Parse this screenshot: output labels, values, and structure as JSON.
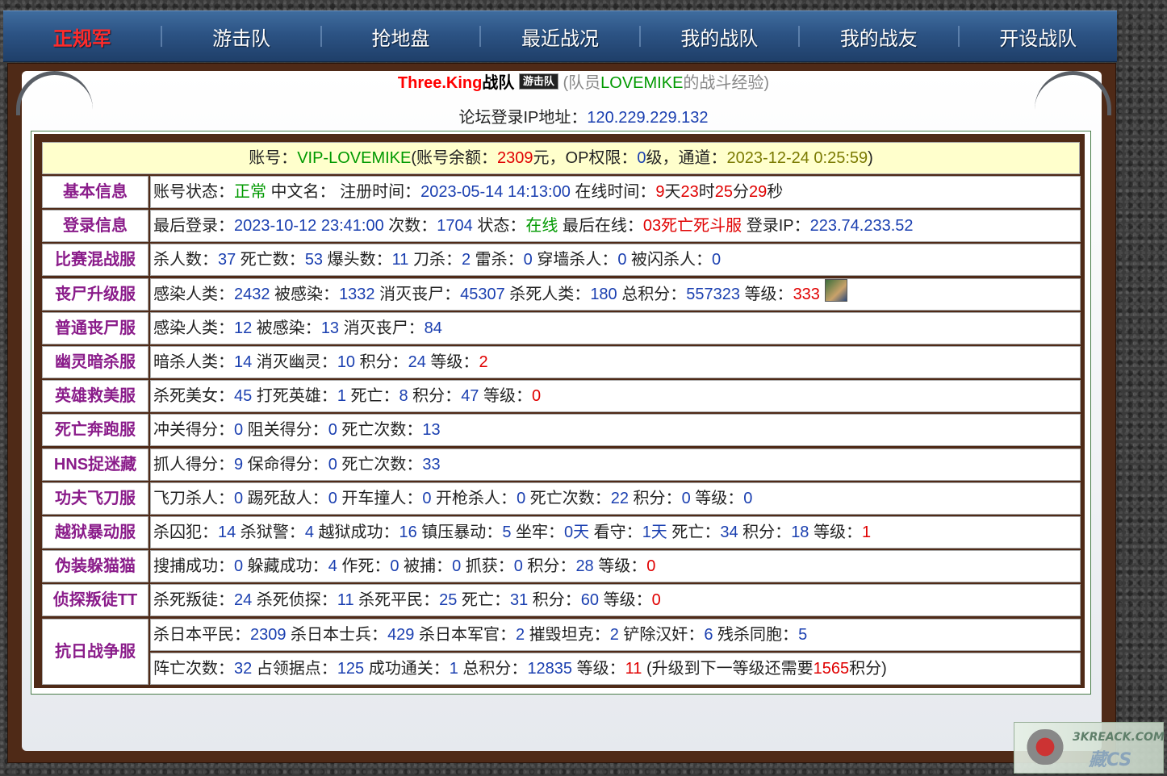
{
  "nav": [
    {
      "label": "正规军",
      "active": true
    },
    {
      "label": "游击队",
      "active": false
    },
    {
      "label": "抢地盘",
      "active": false
    },
    {
      "label": "最近战况",
      "active": false
    },
    {
      "label": "我的战队",
      "active": false
    },
    {
      "label": "我的战友",
      "active": false
    },
    {
      "label": "开设战队",
      "active": false
    }
  ],
  "header": {
    "team_name": "Three.King",
    "team_suffix": "战队",
    "badge": "游击队",
    "desc_prefix": "(队员",
    "member": "LOVEMIKE",
    "desc_suffix": "的战斗经验)"
  },
  "ip_line": {
    "label": "论坛登录IP地址：",
    "value": "120.229.229.132"
  },
  "account": {
    "label": "账号：",
    "account": "VIP-LOVEMIKE",
    "balance_label": "(账号余额：",
    "balance": "2309",
    "balance_unit": "元，",
    "op_label": "OP权限：",
    "op": "0",
    "op_unit": "级，",
    "channel_label": "通道：",
    "channel": "2023-12-24 0:25:59",
    "close": ")"
  },
  "rows": [
    {
      "label": "基本信息",
      "parts": [
        {
          "t": "账号状态："
        },
        {
          "t": "正常",
          "c": "green"
        },
        {
          "t": " 中文名：  注册时间："
        },
        {
          "t": "2023-05-14 14:13:00",
          "c": "blue"
        },
        {
          "t": " 在线时间："
        },
        {
          "t": "9",
          "c": "red"
        },
        {
          "t": "天"
        },
        {
          "t": "23",
          "c": "red"
        },
        {
          "t": "时"
        },
        {
          "t": "25",
          "c": "red"
        },
        {
          "t": "分"
        },
        {
          "t": "29",
          "c": "red"
        },
        {
          "t": "秒"
        }
      ]
    },
    {
      "label": "登录信息",
      "parts": [
        {
          "t": "最后登录："
        },
        {
          "t": "2023-10-12 23:41:00",
          "c": "blue"
        },
        {
          "t": " 次数："
        },
        {
          "t": "1704",
          "c": "blue"
        },
        {
          "t": " 状态："
        },
        {
          "t": "在线",
          "c": "green"
        },
        {
          "t": " 最后在线："
        },
        {
          "t": "03死亡死斗服",
          "c": "red"
        },
        {
          "t": " 登录IP："
        },
        {
          "t": "223.74.233.52",
          "c": "blue"
        }
      ]
    },
    {
      "label": "比赛混战服",
      "parts": [
        {
          "t": "杀人数："
        },
        {
          "t": "37",
          "c": "blue"
        },
        {
          "t": " 死亡数："
        },
        {
          "t": "53",
          "c": "blue"
        },
        {
          "t": " 爆头数："
        },
        {
          "t": "11",
          "c": "blue"
        },
        {
          "t": " 刀杀："
        },
        {
          "t": "2",
          "c": "blue"
        },
        {
          "t": " 雷杀："
        },
        {
          "t": "0",
          "c": "blue"
        },
        {
          "t": " 穿墙杀人："
        },
        {
          "t": "0",
          "c": "blue"
        },
        {
          "t": " 被闪杀人："
        },
        {
          "t": "0",
          "c": "blue"
        }
      ]
    },
    {
      "label": "丧尸升级服",
      "avatar": true,
      "parts": [
        {
          "t": "感染人类："
        },
        {
          "t": "2432",
          "c": "blue"
        },
        {
          "t": " 被感染："
        },
        {
          "t": "1332",
          "c": "blue"
        },
        {
          "t": " 消灭丧尸："
        },
        {
          "t": "45307",
          "c": "blue"
        },
        {
          "t": " 杀死人类："
        },
        {
          "t": "180",
          "c": "blue"
        },
        {
          "t": " 总积分："
        },
        {
          "t": "557323",
          "c": "blue"
        },
        {
          "t": " 等级："
        },
        {
          "t": "333",
          "c": "red"
        }
      ]
    },
    {
      "label": "普通丧尸服",
      "parts": [
        {
          "t": "感染人类："
        },
        {
          "t": "12",
          "c": "blue"
        },
        {
          "t": " 被感染："
        },
        {
          "t": "13",
          "c": "blue"
        },
        {
          "t": " 消灭丧尸："
        },
        {
          "t": "84",
          "c": "blue"
        }
      ]
    },
    {
      "label": "幽灵暗杀服",
      "parts": [
        {
          "t": "暗杀人类："
        },
        {
          "t": "14",
          "c": "blue"
        },
        {
          "t": " 消灭幽灵："
        },
        {
          "t": "10",
          "c": "blue"
        },
        {
          "t": " 积分："
        },
        {
          "t": "24",
          "c": "blue"
        },
        {
          "t": " 等级："
        },
        {
          "t": "2",
          "c": "red"
        }
      ]
    },
    {
      "label": "英雄救美服",
      "parts": [
        {
          "t": "杀死美女："
        },
        {
          "t": "45",
          "c": "blue"
        },
        {
          "t": " 打死英雄："
        },
        {
          "t": "1",
          "c": "blue"
        },
        {
          "t": " 死亡："
        },
        {
          "t": "8",
          "c": "blue"
        },
        {
          "t": " 积分："
        },
        {
          "t": "47",
          "c": "blue"
        },
        {
          "t": " 等级："
        },
        {
          "t": "0",
          "c": "red"
        }
      ]
    },
    {
      "label": "死亡奔跑服",
      "parts": [
        {
          "t": "冲关得分："
        },
        {
          "t": "0",
          "c": "blue"
        },
        {
          "t": " 阻关得分："
        },
        {
          "t": "0",
          "c": "blue"
        },
        {
          "t": " 死亡次数："
        },
        {
          "t": "13",
          "c": "blue"
        }
      ]
    },
    {
      "label": "HNS捉迷藏",
      "parts": [
        {
          "t": "抓人得分："
        },
        {
          "t": "9",
          "c": "blue"
        },
        {
          "t": " 保命得分："
        },
        {
          "t": "0",
          "c": "blue"
        },
        {
          "t": " 死亡次数："
        },
        {
          "t": "33",
          "c": "blue"
        }
      ]
    },
    {
      "label": "功夫飞刀服",
      "parts": [
        {
          "t": "飞刀杀人："
        },
        {
          "t": "0",
          "c": "blue"
        },
        {
          "t": " 踢死敌人："
        },
        {
          "t": "0",
          "c": "blue"
        },
        {
          "t": " 开车撞人："
        },
        {
          "t": "0",
          "c": "blue"
        },
        {
          "t": " 开枪杀人："
        },
        {
          "t": "0",
          "c": "blue"
        },
        {
          "t": " 死亡次数："
        },
        {
          "t": "22",
          "c": "blue"
        },
        {
          "t": " 积分："
        },
        {
          "t": "0",
          "c": "blue"
        },
        {
          "t": " 等级："
        },
        {
          "t": "0",
          "c": "blue"
        }
      ]
    },
    {
      "label": "越狱暴动服",
      "parts": [
        {
          "t": "杀囚犯："
        },
        {
          "t": "14",
          "c": "blue"
        },
        {
          "t": " 杀狱警："
        },
        {
          "t": "4",
          "c": "blue"
        },
        {
          "t": " 越狱成功："
        },
        {
          "t": "16",
          "c": "blue"
        },
        {
          "t": " 镇压暴动："
        },
        {
          "t": "5",
          "c": "blue"
        },
        {
          "t": " 坐牢："
        },
        {
          "t": "0天",
          "c": "blue"
        },
        {
          "t": " 看守："
        },
        {
          "t": "1天",
          "c": "blue"
        },
        {
          "t": " 死亡："
        },
        {
          "t": "34",
          "c": "blue"
        },
        {
          "t": " 积分："
        },
        {
          "t": "18",
          "c": "blue"
        },
        {
          "t": " 等级："
        },
        {
          "t": "1",
          "c": "red"
        }
      ]
    },
    {
      "label": "伪装躲猫猫",
      "parts": [
        {
          "t": "搜捕成功："
        },
        {
          "t": "0",
          "c": "blue"
        },
        {
          "t": " 躲藏成功："
        },
        {
          "t": "4",
          "c": "blue"
        },
        {
          "t": " 作死："
        },
        {
          "t": "0",
          "c": "blue"
        },
        {
          "t": " 被捕："
        },
        {
          "t": "0",
          "c": "blue"
        },
        {
          "t": " 抓获："
        },
        {
          "t": "0",
          "c": "blue"
        },
        {
          "t": " 积分："
        },
        {
          "t": "28",
          "c": "blue"
        },
        {
          "t": " 等级："
        },
        {
          "t": "0",
          "c": "red"
        }
      ]
    },
    {
      "label": "侦探叛徒TT",
      "parts": [
        {
          "t": "杀死叛徒："
        },
        {
          "t": "24",
          "c": "blue"
        },
        {
          "t": " 杀死侦探："
        },
        {
          "t": "11",
          "c": "blue"
        },
        {
          "t": " 杀死平民："
        },
        {
          "t": "25",
          "c": "blue"
        },
        {
          "t": " 死亡："
        },
        {
          "t": "31",
          "c": "blue"
        },
        {
          "t": " 积分："
        },
        {
          "t": "60",
          "c": "blue"
        },
        {
          "t": " 等级："
        },
        {
          "t": "0",
          "c": "red"
        }
      ]
    }
  ],
  "kangri": {
    "label": "抗日战争服",
    "lines": [
      [
        {
          "t": "杀日本平民："
        },
        {
          "t": "2309",
          "c": "blue"
        },
        {
          "t": " 杀日本士兵："
        },
        {
          "t": "429",
          "c": "blue"
        },
        {
          "t": " 杀日本军官："
        },
        {
          "t": "2",
          "c": "blue"
        },
        {
          "t": " 摧毁坦克："
        },
        {
          "t": "2",
          "c": "blue"
        },
        {
          "t": " 铲除汉奸："
        },
        {
          "t": "6",
          "c": "blue"
        },
        {
          "t": " 残杀同胞："
        },
        {
          "t": "5",
          "c": "blue"
        }
      ],
      [
        {
          "t": "阵亡次数："
        },
        {
          "t": "32",
          "c": "blue"
        },
        {
          "t": " 占领据点："
        },
        {
          "t": "125",
          "c": "blue"
        },
        {
          "t": " 成功通关："
        },
        {
          "t": "1",
          "c": "blue"
        },
        {
          "t": " 总积分："
        },
        {
          "t": "12835",
          "c": "blue"
        },
        {
          "t": " 等级："
        },
        {
          "t": "11",
          "c": "red"
        },
        {
          "t": " (升级到下一等级还需要"
        },
        {
          "t": "1565",
          "c": "red"
        },
        {
          "t": "积分)"
        }
      ]
    ]
  },
  "watermark": {
    "line1": "3KREACK.COM",
    "line2": "藏CS"
  },
  "colors": {
    "green": "#009900",
    "blue": "#1a3fb0",
    "red": "#e00000",
    "label": "#8a1c8a",
    "nav_active": "#ff2b2b"
  }
}
